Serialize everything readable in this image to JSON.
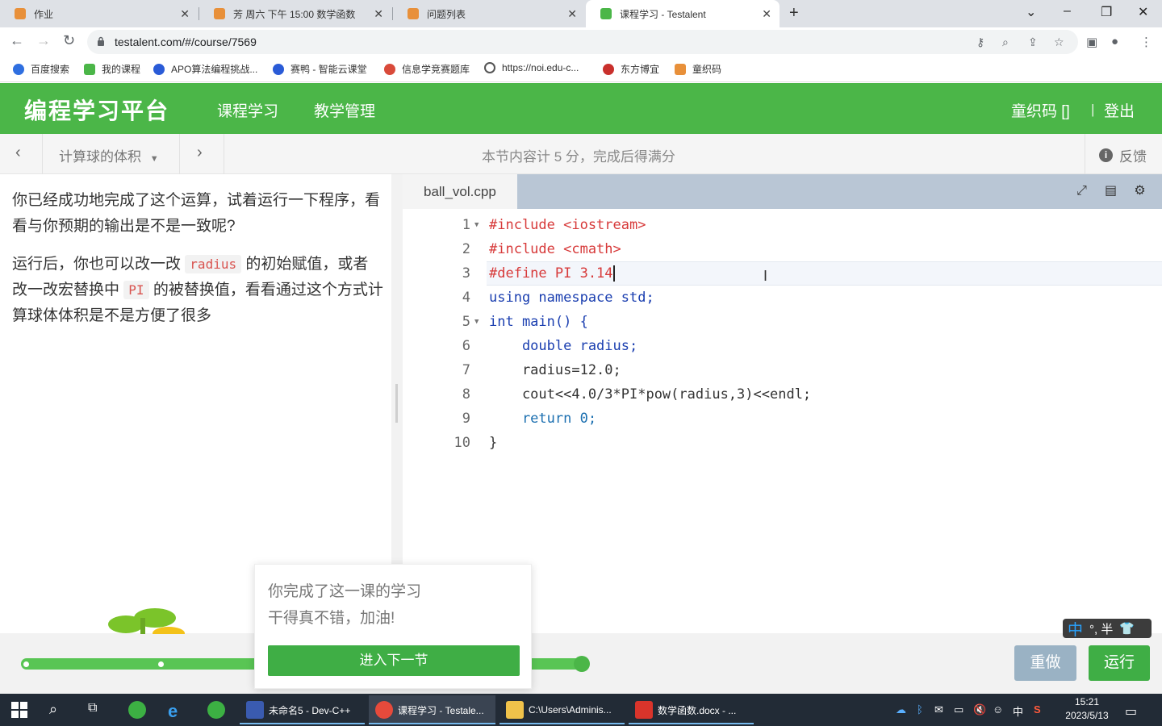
{
  "browser": {
    "tabs": [
      {
        "title": "作业",
        "active": false
      },
      {
        "title": "芳 周六 下午 15:00 数学函数",
        "active": false
      },
      {
        "title": "问题列表",
        "active": false
      },
      {
        "title": "课程学习 - Testalent",
        "active": true
      }
    ],
    "url": "testalent.com/#/course/7569",
    "bookmarks": [
      "百度搜索",
      "我的课程",
      "APO算法编程挑战...",
      "赛鸭 - 智能云课堂",
      "信息学竞赛题库",
      "https://noi.edu-c...",
      "东方博宜",
      "童织码"
    ]
  },
  "site": {
    "logo": "编程学习平台",
    "nav": [
      "课程学习",
      "教学管理"
    ],
    "user": "童织码 []",
    "separator": "|",
    "logout": "登出"
  },
  "lesson": {
    "title": "计算球的体积",
    "info": "本节内容计 5 分，完成后得满分",
    "feedback": "反馈"
  },
  "instructions": {
    "p1": "你已经成功地完成了这个运算，试着运行一下程序，看看与你预期的输出是不是一致呢?",
    "p2_a": "运行后，你也可以改一改",
    "p2_code1": "radius",
    "p2_b": "的初始赋值，或者改一改宏替换中",
    "p2_code2": "PI",
    "p2_c": "的被替换值，看看通过这个方式计算球体体积是不是方便了很多"
  },
  "editor": {
    "filename": "ball_vol.cpp",
    "lines": [
      {
        "n": "1",
        "fold": true
      },
      {
        "n": "2",
        "fold": false
      },
      {
        "n": "3",
        "fold": false
      },
      {
        "n": "4",
        "fold": false
      },
      {
        "n": "5",
        "fold": true
      },
      {
        "n": "6",
        "fold": false
      },
      {
        "n": "7",
        "fold": false
      },
      {
        "n": "8",
        "fold": false
      },
      {
        "n": "9",
        "fold": false
      },
      {
        "n": "10",
        "fold": false
      }
    ],
    "code": [
      "#include <iostream>",
      "#include <cmath>",
      "#define PI 3.14",
      "using namespace std;",
      "int main() {",
      "    double radius;",
      "    radius=12.0;",
      "    cout<<4.0/3*PI*pow(radius,3)<<endl;",
      "    return 0;",
      "}"
    ]
  },
  "popup": {
    "line1": "你完成了这一课的学习",
    "line2": "干得真不错，加油!",
    "next_button": "进入下一节"
  },
  "footer": {
    "progress": 1.0,
    "redo": "重做",
    "run": "运行"
  },
  "ime": {
    "lang": "中",
    "rest": "°, 半"
  },
  "taskbar": {
    "apps": [
      "未命名5 - Dev-C++",
      "课程学习 - Testale...",
      "C:\\Users\\Adminis...",
      "数学函数.docx - ..."
    ],
    "tray_lang": "中",
    "time": "15:21",
    "date": "2023/5/13"
  },
  "colors": {
    "brand_green": "#4bb648",
    "button_green": "#3fae45",
    "redo_gray_blue": "#9ab2c4",
    "editor_tab_bar": "#b9c6d5"
  }
}
